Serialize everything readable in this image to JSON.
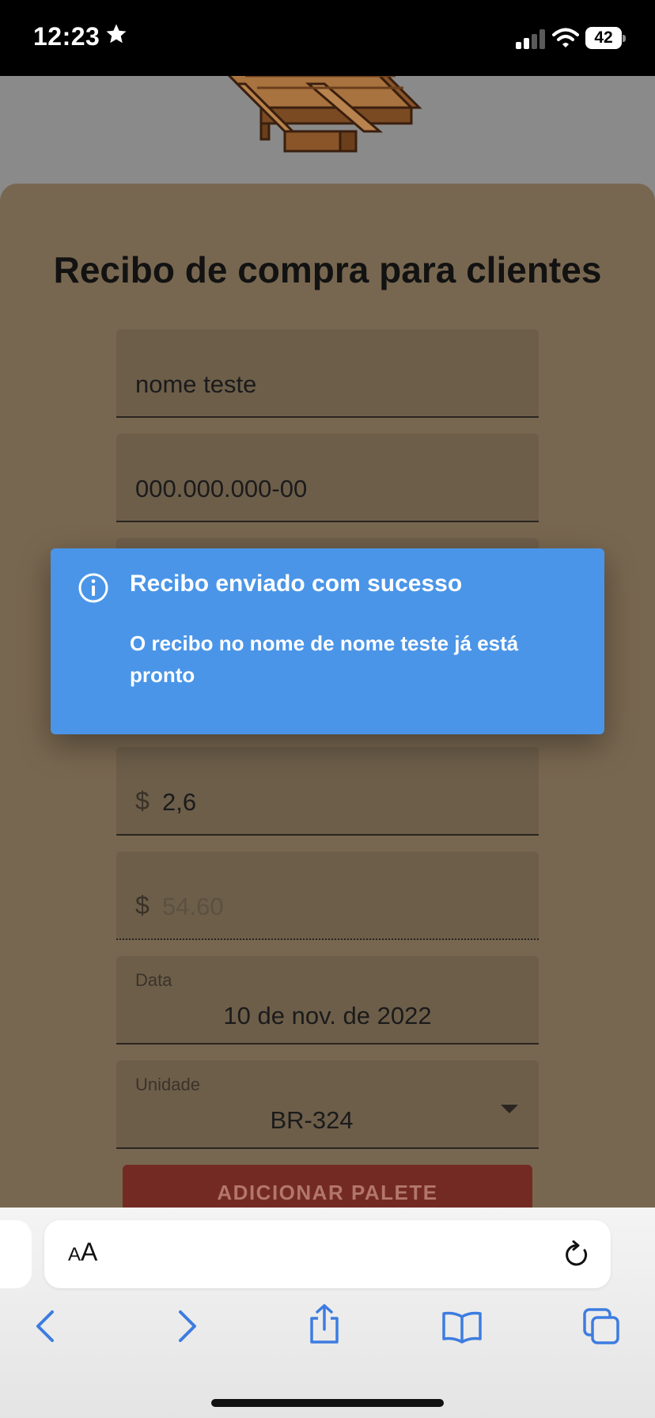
{
  "status_bar": {
    "time": "12:23",
    "battery": "42"
  },
  "form": {
    "title": "Recibo de compra para clientes",
    "name_value": "nome teste",
    "cpf_value": "000.000.000-00",
    "price_prefix": "$",
    "price_value": "2,6",
    "total_prefix": "$",
    "total_placeholder": "54.60",
    "date_label": "Data",
    "date_value": "10 de nov. de 2022",
    "unit_label": "Unidade",
    "unit_value": "BR-324",
    "add_button": "ADICIONAR PALETE"
  },
  "toast": {
    "title": "Recibo enviado com sucesso",
    "message": "O recibo no nome de nome teste já está pronto",
    "icon": "info-icon",
    "color": "#4a95e8"
  },
  "browser": {
    "text_size_small": "A",
    "text_size_big": "A",
    "icons": [
      "back-icon",
      "forward-icon",
      "share-icon",
      "bookmarks-icon",
      "tabs-icon",
      "reload-icon"
    ]
  },
  "colors": {
    "card": "#786750",
    "field": "#6d5e4a",
    "button": "#732a22"
  }
}
